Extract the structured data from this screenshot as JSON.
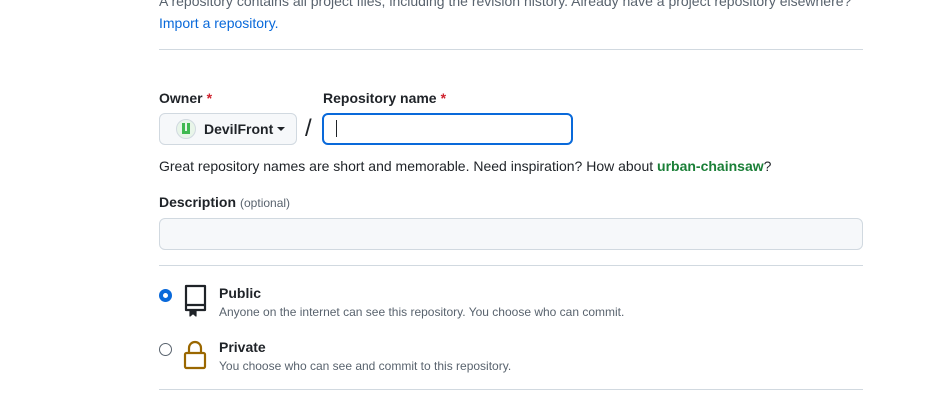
{
  "intro": {
    "text": "A repository contains all project files, including the revision history. Already have a project repository elsewhere?",
    "import_link": "Import a repository."
  },
  "owner": {
    "label": "Owner",
    "required_mark": "*",
    "value": "DevilFront"
  },
  "repo_name": {
    "label": "Repository name",
    "required_mark": "*",
    "value": "",
    "separator": "/"
  },
  "hint": {
    "prefix": "Great repository names are short and memorable. Need inspiration? How about ",
    "suggestion": "urban-chainsaw",
    "suffix": "?"
  },
  "description": {
    "label": "Description",
    "optional": "(optional)",
    "value": ""
  },
  "visibility": {
    "selected": "public",
    "options": [
      {
        "id": "public",
        "title": "Public",
        "desc": "Anyone on the internet can see this repository. You choose who can commit.",
        "icon": "repo-icon"
      },
      {
        "id": "private",
        "title": "Private",
        "desc": "You choose who can see and commit to this repository.",
        "icon": "lock-icon"
      }
    ]
  },
  "colors": {
    "accent": "#0969da",
    "success": "#1a7f37",
    "danger": "#cf222e",
    "private_icon": "#9a6700"
  }
}
